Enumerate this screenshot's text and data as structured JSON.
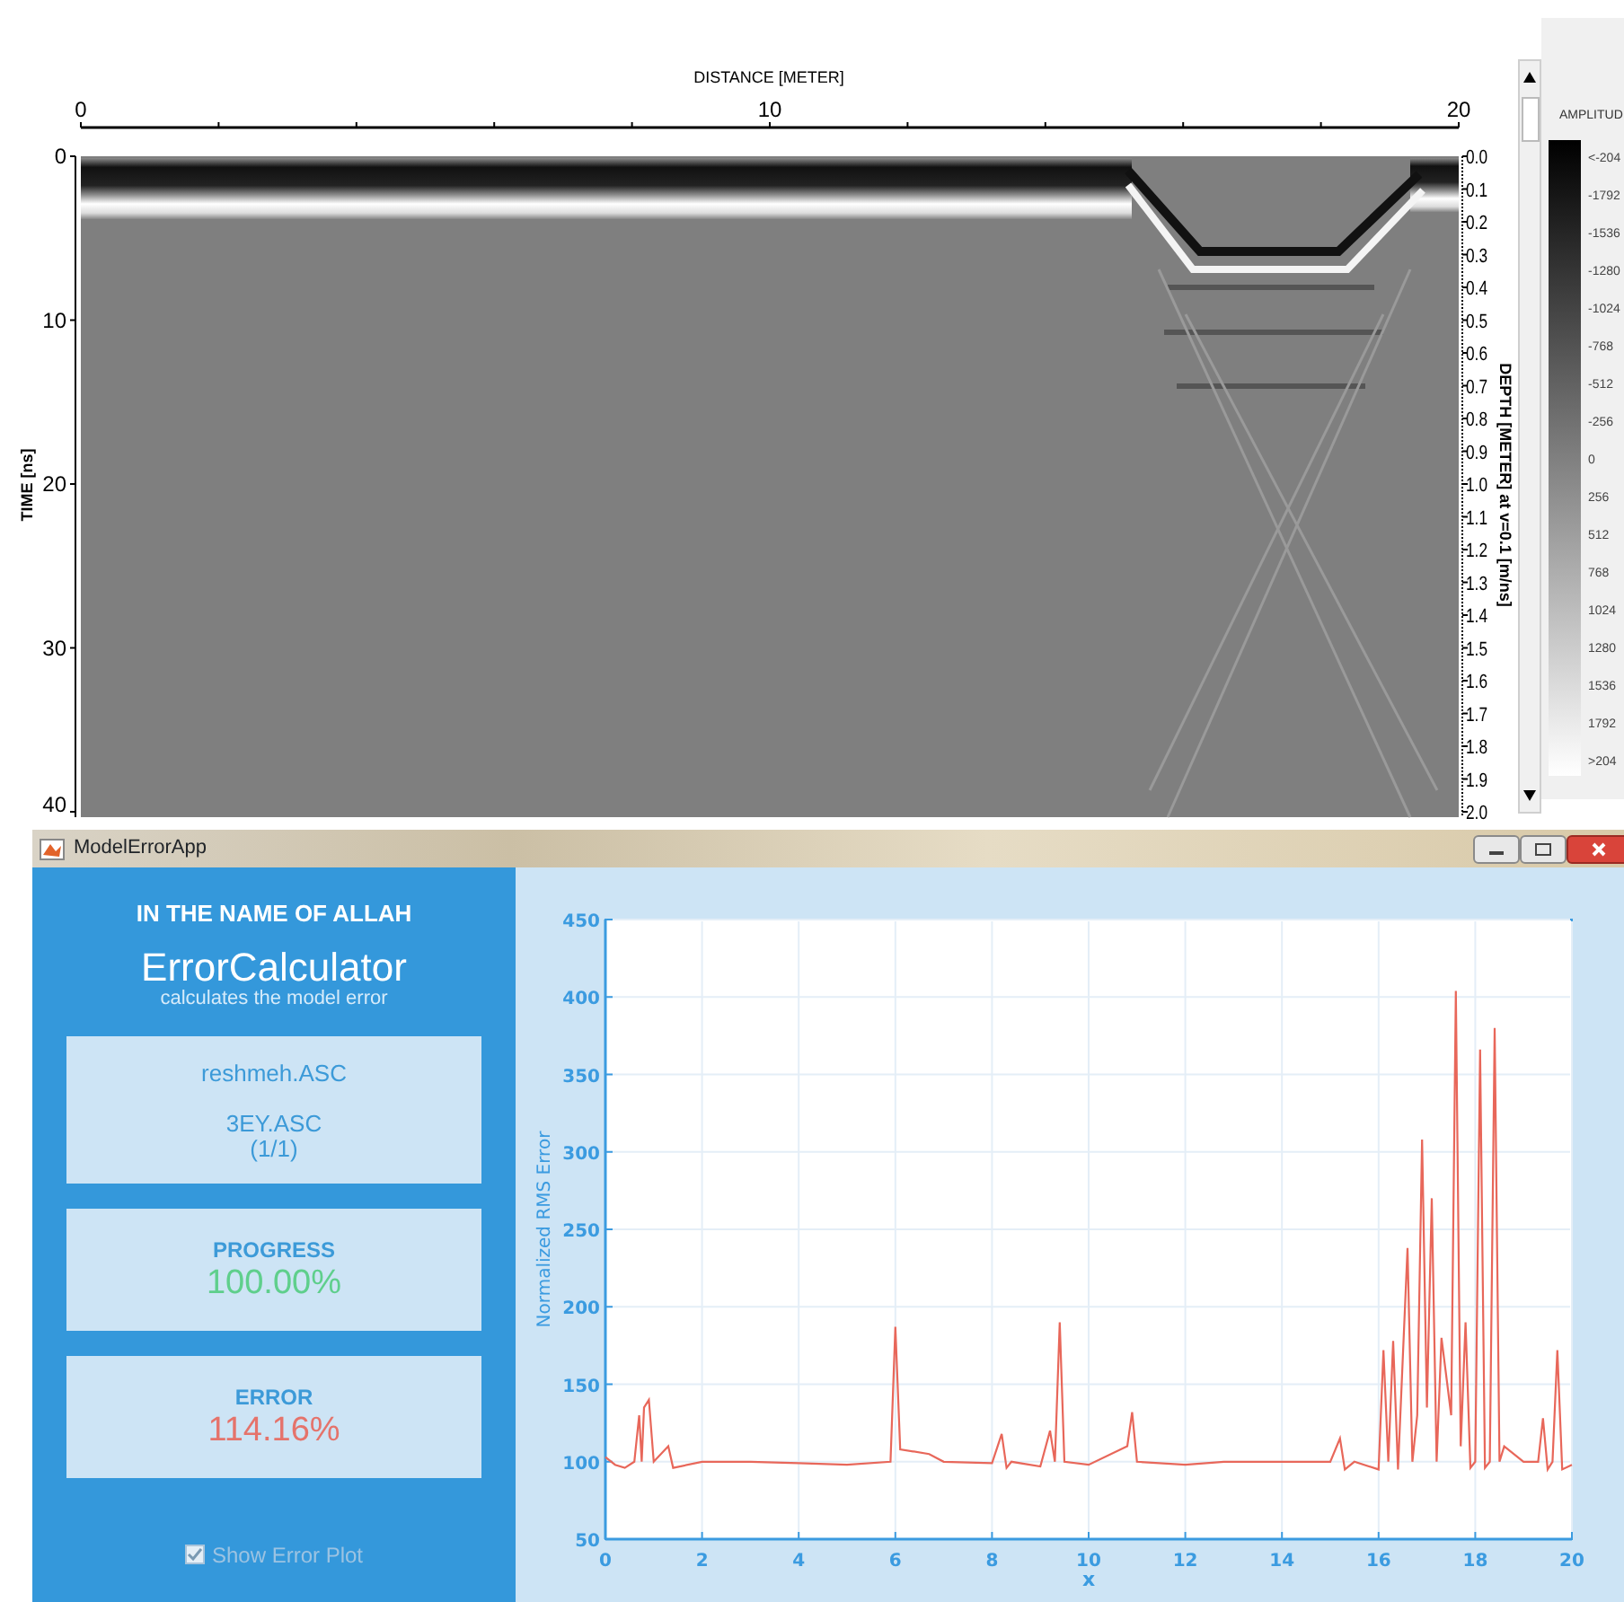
{
  "radargram": {
    "x_axis_title": "DISTANCE [METER]",
    "x_ticks": [
      "0",
      "10",
      "20"
    ],
    "time_axis_title": "TIME [ns]",
    "time_ticks": [
      "0",
      "10",
      "20",
      "30",
      "40"
    ],
    "depth_axis_title": "DEPTH [METER] at v=0.1 [m/ns]",
    "depth_ticks": [
      "0.0",
      "0.1",
      "0.2",
      "0.3",
      "0.4",
      "0.5",
      "0.6",
      "0.7",
      "0.8",
      "0.9",
      "1.0",
      "1.1",
      "1.2",
      "1.3",
      "1.4",
      "1.5",
      "1.6",
      "1.7",
      "1.8",
      "1.9",
      "2.0"
    ]
  },
  "colorbar": {
    "title": "AMPLITUD",
    "labels": [
      "<-204",
      "-1792",
      "-1536",
      "-1280",
      "-1024",
      "-768",
      "-512",
      "-256",
      "0",
      "256",
      "512",
      "768",
      "1024",
      "1280",
      "1536",
      "1792",
      ">204"
    ]
  },
  "window": {
    "title": "ModelErrorApp"
  },
  "sidebar": {
    "heading": "IN THE NAME OF ALLAH",
    "app_name": "ErrorCalculator",
    "tagline": "calculates the model error",
    "files": {
      "model": "reshmeh.ASC",
      "data": "3EY.ASC",
      "count": "(1/1)"
    },
    "progress": {
      "label": "PROGRESS",
      "value": "100.00%"
    },
    "error": {
      "label": "ERROR",
      "value": "114.16%"
    },
    "show_error_plot": {
      "label": "Show Error Plot",
      "checked": true
    }
  },
  "error_plot": {
    "chart_data": {
      "type": "line",
      "xlabel": "x",
      "ylabel": "Normalized RMS Error",
      "xlim": [
        0,
        20
      ],
      "ylim": [
        50,
        450
      ],
      "xticks": [
        0,
        2,
        4,
        6,
        8,
        10,
        12,
        14,
        16,
        18,
        20
      ],
      "yticks": [
        50,
        100,
        150,
        200,
        250,
        300,
        350,
        400,
        450
      ],
      "grid": true,
      "x": [
        0,
        0.2,
        0.4,
        0.6,
        0.7,
        0.75,
        0.8,
        0.9,
        1.0,
        1.3,
        1.4,
        2,
        3,
        4,
        5,
        5.9,
        6.0,
        6.1,
        6.7,
        7,
        8,
        8.2,
        8.3,
        8.4,
        9,
        9.2,
        9.3,
        9.4,
        9.5,
        10,
        10.8,
        10.9,
        11,
        12,
        12.8,
        13,
        14.2,
        15,
        15.2,
        15.3,
        15.5,
        16,
        16.1,
        16.2,
        16.3,
        16.4,
        16.6,
        16.7,
        16.8,
        16.9,
        17.0,
        17.1,
        17.2,
        17.3,
        17.5,
        17.6,
        17.7,
        17.8,
        17.9,
        18.0,
        18.1,
        18.2,
        18.3,
        18.4,
        18.5,
        18.6,
        19,
        19.3,
        19.4,
        19.5,
        19.6,
        19.7,
        19.8,
        20
      ],
      "series": [
        {
          "color": "#e8675a",
          "values": [
            103,
            98,
            96,
            100,
            130,
            100,
            135,
            140,
            100,
            110,
            96,
            100,
            100,
            99,
            98,
            100,
            187,
            108,
            105,
            100,
            99,
            118,
            96,
            100,
            97,
            120,
            100,
            190,
            100,
            98,
            110,
            132,
            100,
            98,
            100,
            100,
            100,
            100,
            115,
            95,
            100,
            95,
            172,
            100,
            178,
            95,
            238,
            100,
            130,
            308,
            135,
            270,
            100,
            180,
            130,
            404,
            110,
            190,
            96,
            100,
            366,
            96,
            100,
            380,
            100,
            110,
            100,
            100,
            128,
            95,
            100,
            172,
            95,
            98
          ]
        }
      ]
    }
  }
}
